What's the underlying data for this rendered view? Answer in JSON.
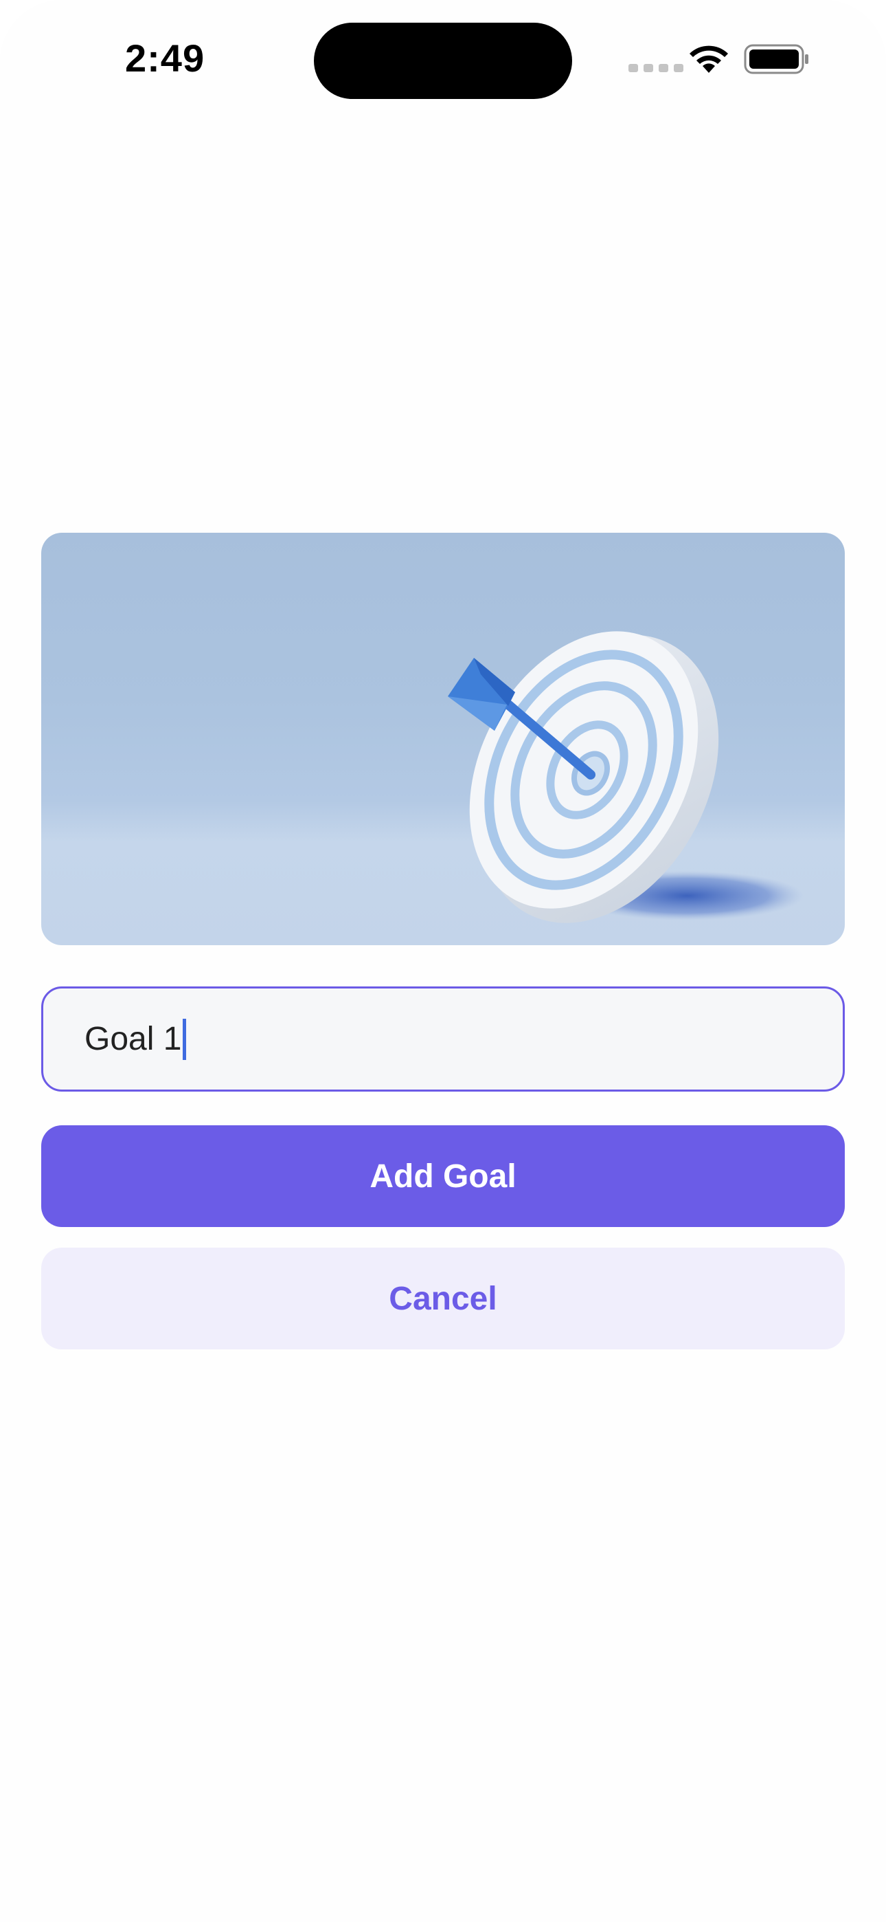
{
  "status_bar": {
    "time": "2:49"
  },
  "hero": {
    "icon": "target-dart-illustration"
  },
  "goal_input": {
    "value": "Goal 1",
    "placeholder": ""
  },
  "buttons": {
    "add_label": "Add Goal",
    "cancel_label": "Cancel"
  },
  "colors": {
    "accent": "#6b5ce7",
    "cancel_bg": "#f0eefc",
    "input_border": "#6b5ae6"
  }
}
